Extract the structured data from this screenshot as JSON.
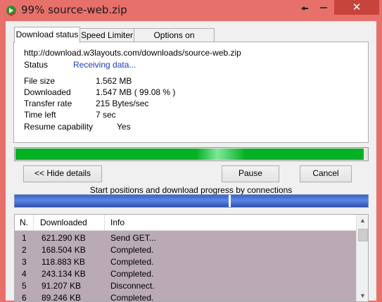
{
  "window": {
    "title": "99% source-web.zip",
    "close_symbol": "✕"
  },
  "tabs": [
    {
      "label": "Download status"
    },
    {
      "label": "Speed Limiter"
    },
    {
      "label": "Options on completion"
    }
  ],
  "status": {
    "url": "http://download.w3layouts.com/downloads/source-web.zip",
    "status_label": "Status",
    "status_value": "Receiving data...",
    "file_size_label": "File size",
    "file_size_value": "1.562  MB",
    "downloaded_label": "Downloaded",
    "downloaded_value": "1.547  MB  ( 99.08 % )",
    "transfer_rate_label": "Transfer rate",
    "transfer_rate_value": "215  Bytes/sec",
    "time_left_label": "Time left",
    "time_left_value": "7 sec",
    "resume_label": "Resume capability",
    "resume_value": "Yes"
  },
  "progress": {
    "fraction": 0.9908,
    "color": "#06b025"
  },
  "buttons": {
    "hide_details": "<< Hide details",
    "pause": "Pause",
    "cancel": "Cancel"
  },
  "connections": {
    "caption": "Start positions and download progress by connections"
  },
  "table": {
    "headers": [
      "N.",
      "Downloaded",
      "Info"
    ],
    "rows": [
      {
        "n": "1",
        "downloaded": "621.290  KB",
        "info": "Send GET..."
      },
      {
        "n": "2",
        "downloaded": "168.504  KB",
        "info": "Completed."
      },
      {
        "n": "3",
        "downloaded": "118.883  KB",
        "info": "Completed."
      },
      {
        "n": "4",
        "downloaded": "243.134  KB",
        "info": "Completed."
      },
      {
        "n": "5",
        "downloaded": "91.207  KB",
        "info": "Disconnect."
      },
      {
        "n": "6",
        "downloaded": "89.246  KB",
        "info": "Completed."
      }
    ]
  },
  "colors": {
    "window_frame": "#e8706a",
    "close_button": "#c7443c",
    "link_blue": "#1a3cb8",
    "row_bg": "#b9aab6"
  }
}
